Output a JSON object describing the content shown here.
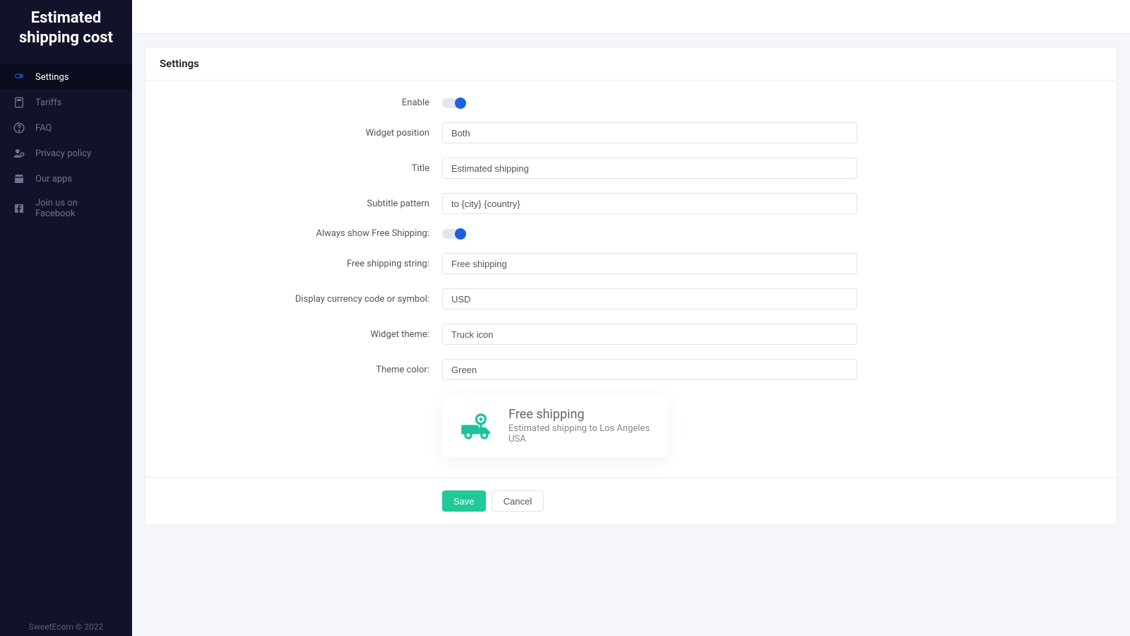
{
  "app": {
    "title": "Estimated shipping cost"
  },
  "sidebar": {
    "items": [
      {
        "label": "Settings",
        "icon": "toggle-icon"
      },
      {
        "label": "Tariffs",
        "icon": "calc-icon"
      },
      {
        "label": "FAQ",
        "icon": "help-icon"
      },
      {
        "label": "Privacy policy",
        "icon": "privacy-icon"
      },
      {
        "label": "Our apps",
        "icon": "apps-icon"
      },
      {
        "label": "Join us on Facebook",
        "icon": "facebook-icon"
      }
    ],
    "footer": "SweetEcom © 2022"
  },
  "page": {
    "title": "Settings"
  },
  "form": {
    "enable_label": "Enable",
    "enable": true,
    "widget_position_label": "Widget position",
    "widget_position": "Both",
    "title_label": "Title",
    "title": "Estimated shipping",
    "subtitle_label": "Subtitle pattern",
    "subtitle": "to {city} {country}",
    "always_free_label": "Always show Free Shipping:",
    "always_free": true,
    "free_string_label": "Free shipping string:",
    "free_string": "Free shipping",
    "currency_label": "Display currency code or symbol:",
    "currency": "USD",
    "theme_label": "Widget theme:",
    "theme": "Truck icon",
    "color_label": "Theme color:",
    "color": "Green"
  },
  "preview": {
    "title": "Free shipping",
    "subtitle": "Estimated shipping to Los Angeles USA"
  },
  "actions": {
    "save": "Save",
    "cancel": "Cancel"
  }
}
